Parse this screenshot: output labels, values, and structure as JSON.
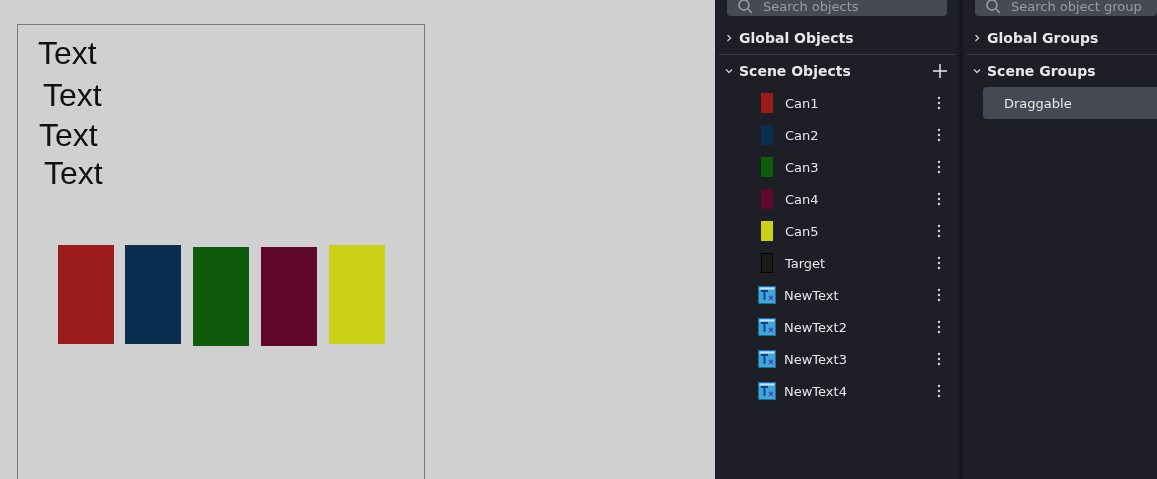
{
  "canvas": {
    "texts": [
      "Text",
      "Text",
      "Text",
      "Text"
    ],
    "shapes": [
      {
        "color": "#9b1b1b"
      },
      {
        "color": "#0a2e50"
      },
      {
        "color": "#0e5c0b"
      },
      {
        "color": "#5f0829"
      },
      {
        "color": "#cad013"
      }
    ]
  },
  "objects_panel": {
    "search": {
      "placeholder": "Search objects"
    },
    "sections": [
      {
        "title": "Global Objects",
        "expanded": false,
        "add": false
      },
      {
        "title": "Scene Objects",
        "expanded": true,
        "add": true,
        "items": [
          {
            "label": "Can1",
            "kind": "swatch",
            "color": "#9b1b1b"
          },
          {
            "label": "Can2",
            "kind": "swatch",
            "color": "#0a2e50"
          },
          {
            "label": "Can3",
            "kind": "swatch",
            "color": "#0e5c0b"
          },
          {
            "label": "Can4",
            "kind": "swatch",
            "color": "#5f0829"
          },
          {
            "label": "Can5",
            "kind": "swatch",
            "color": "#cad013"
          },
          {
            "label": "Target",
            "kind": "outline"
          },
          {
            "label": "NewText",
            "kind": "text"
          },
          {
            "label": "NewText2",
            "kind": "text"
          },
          {
            "label": "NewText3",
            "kind": "text"
          },
          {
            "label": "NewText4",
            "kind": "text"
          }
        ]
      }
    ]
  },
  "groups_panel": {
    "search": {
      "placeholder": "Search object group"
    },
    "sections": [
      {
        "title": "Global Groups",
        "expanded": false
      },
      {
        "title": "Scene Groups",
        "expanded": true,
        "items": [
          {
            "label": "Draggable",
            "selected": true
          }
        ]
      }
    ]
  }
}
